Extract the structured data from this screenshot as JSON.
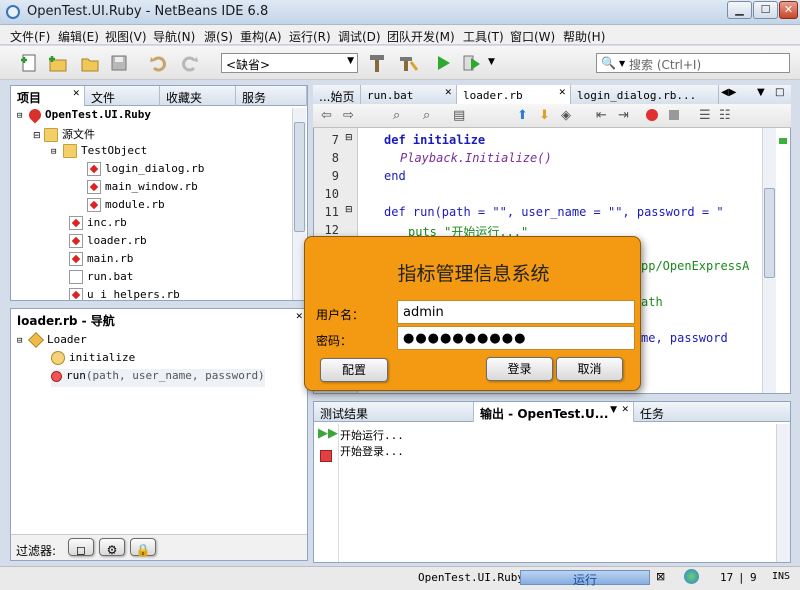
{
  "window": {
    "title": "OpenTest.UI.Ruby - NetBeans IDE 6.8",
    "min": "▁",
    "max": "☐",
    "close": "✕"
  },
  "menu": [
    "文件(F)",
    "编辑(E)",
    "视图(V)",
    "导航(N)",
    "源(S)",
    "重构(A)",
    "运行(R)",
    "调试(D)",
    "团队开发(M)",
    "工具(T)",
    "窗口(W)",
    "帮助(H)"
  ],
  "toolbar": {
    "config_value": "<缺省>",
    "search_placeholder": "搜索 (Ctrl+I)"
  },
  "projects_panel": {
    "tabs": [
      "项目",
      "文件",
      "收藏夹",
      "服务"
    ],
    "project_name": "OpenTest.UI.Ruby",
    "source_folder": "源文件",
    "items": [
      {
        "label": "TestObject",
        "type": "folder"
      },
      {
        "label": "login_dialog.rb",
        "type": "ruby"
      },
      {
        "label": "main_window.rb",
        "type": "ruby"
      },
      {
        "label": "module.rb",
        "type": "ruby"
      },
      {
        "label": "inc.rb",
        "type": "ruby"
      },
      {
        "label": "loader.rb",
        "type": "ruby"
      },
      {
        "label": "main.rb",
        "type": "ruby"
      },
      {
        "label": "run.bat",
        "type": "file"
      },
      {
        "label": "u_i_helpers.rb",
        "type": "ruby"
      }
    ]
  },
  "navigator_panel": {
    "title": "loader.rb - 导航",
    "class_name": "Loader",
    "methods": [
      {
        "name": "initialize",
        "params": ""
      },
      {
        "name": "run",
        "params": "(path, user_name, password)"
      }
    ],
    "filter_label": "过滤器:"
  },
  "editor": {
    "tabs": [
      "...始页",
      "run.bat",
      "loader.rb",
      "login_dialog.rb..."
    ],
    "lines": [
      {
        "num": "7",
        "text": "def initialize"
      },
      {
        "num": "8",
        "text": "Playback.Initialize()"
      },
      {
        "num": "9",
        "text": "end"
      },
      {
        "num": "10",
        "text": ""
      },
      {
        "num": "11",
        "text": "def run(path = \"\", user_name = \"\", password = \""
      },
      {
        "num": "12",
        "text": "puts \"开始运行...\""
      }
    ],
    "partial_right": [
      "pp/OpenExpressA",
      "ath",
      "me, password"
    ]
  },
  "dialog": {
    "title": "指标管理信息系统",
    "username_label": "用户名：",
    "username_value": "admin",
    "password_label": "密码：",
    "password_value": "●●●●●●●●●●",
    "config_button": "配置",
    "login_button": "登录",
    "cancel_button": "取消"
  },
  "output_panel": {
    "tabs": [
      "测试结果",
      "输出 - OpenTest.U...",
      "任务"
    ],
    "lines": [
      "开始运行...",
      "开始登录..."
    ]
  },
  "status": {
    "project": "OpenTest.UI.Ruby",
    "task": "运行",
    "row": "17",
    "col": "9",
    "mode": "INS"
  },
  "colors": {
    "dialog_bg": "#f39a12",
    "keyword": "#1b1bbd",
    "string": "#1a8a1a"
  }
}
